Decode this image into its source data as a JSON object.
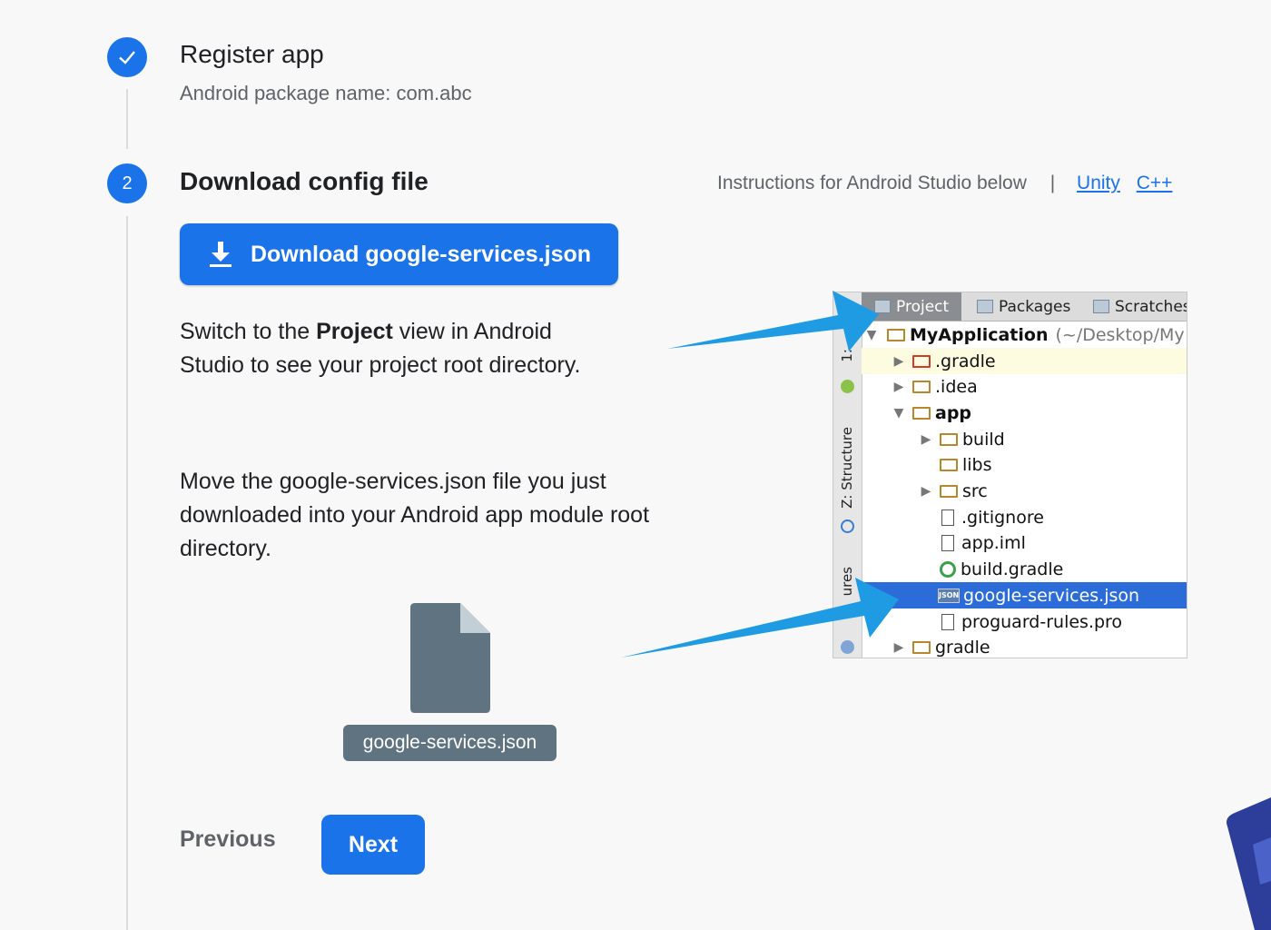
{
  "steps": [
    {
      "number": "",
      "title": "Register app",
      "subtitle": "Android package name: com.abc",
      "state": "done"
    },
    {
      "number": "2",
      "title": "Download config file",
      "state": "active"
    }
  ],
  "instructions": {
    "text": "Instructions for Android Studio below",
    "separator": "|",
    "links": [
      "Unity",
      "C++"
    ]
  },
  "download_button": {
    "label": "Download google-services.json",
    "icon": "download-icon"
  },
  "paragraph1": {
    "before": "Switch to the ",
    "bold": "Project",
    "after": " view in Android Studio to see your project root directory."
  },
  "paragraph2": "Move the google-services.json file you just downloaded into your Android app module root directory.",
  "file_card": {
    "label": "google-services.json",
    "icon": "file-icon"
  },
  "nav": {
    "previous": "Previous",
    "next": "Next"
  },
  "ide": {
    "tabs": [
      "Project",
      "Packages",
      "Scratches"
    ],
    "side_labels": [
      "1:",
      "Z: Structure",
      "ures"
    ],
    "root": {
      "name": "MyApplication",
      "path": "(~/Desktop/My"
    },
    "tree": [
      {
        "label": ".gradle",
        "type": "folder-red",
        "depth": 1,
        "expand": "closed",
        "highlight": true
      },
      {
        "label": ".idea",
        "type": "folder",
        "depth": 1,
        "expand": "closed"
      },
      {
        "label": "app",
        "type": "folder-module",
        "depth": 1,
        "expand": "open",
        "bold": true
      },
      {
        "label": "build",
        "type": "folder",
        "depth": 2,
        "expand": "closed"
      },
      {
        "label": "libs",
        "type": "folder",
        "depth": 2,
        "expand": "none"
      },
      {
        "label": "src",
        "type": "folder",
        "depth": 2,
        "expand": "closed"
      },
      {
        "label": ".gitignore",
        "type": "file",
        "depth": 2,
        "expand": "none"
      },
      {
        "label": "app.iml",
        "type": "file",
        "depth": 2,
        "expand": "none"
      },
      {
        "label": "build.gradle",
        "type": "gradle",
        "depth": 2,
        "expand": "none"
      },
      {
        "label": "google-services.json",
        "type": "json",
        "depth": 2,
        "expand": "none",
        "selected": true
      },
      {
        "label": "proguard-rules.pro",
        "type": "file",
        "depth": 2,
        "expand": "none"
      },
      {
        "label": "gradle",
        "type": "folder",
        "depth": 1,
        "expand": "closed"
      }
    ]
  },
  "colors": {
    "primary": "#1a73e8",
    "arrow": "#1e9be3",
    "selection": "#2c6cd9"
  }
}
